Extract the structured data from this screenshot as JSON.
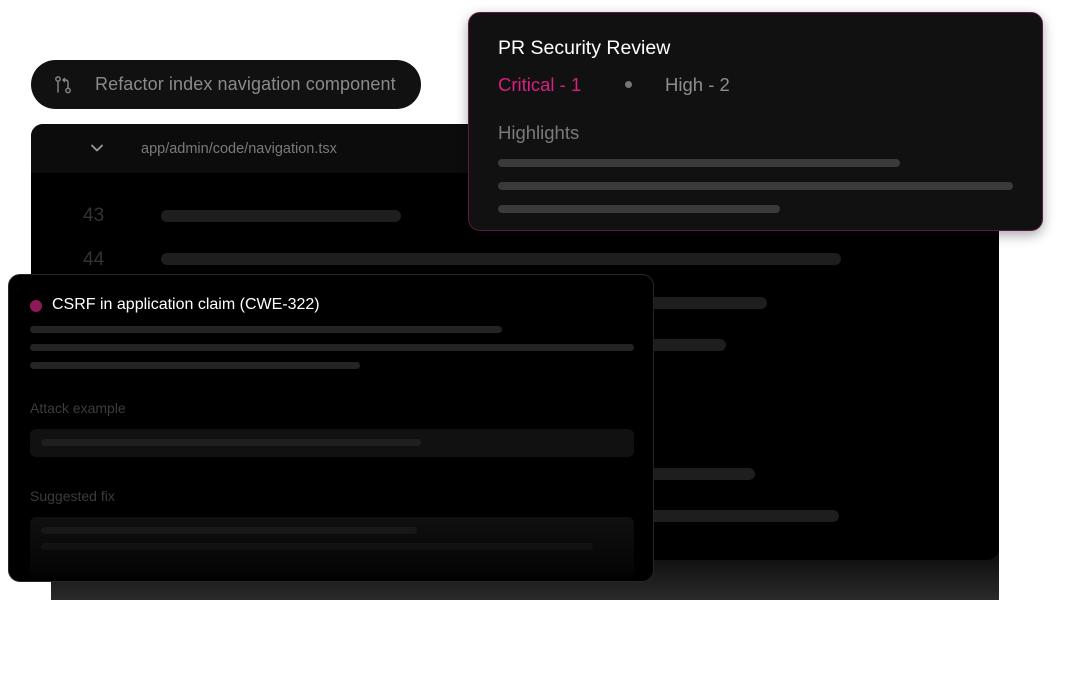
{
  "pull_request": {
    "icon": "git-pull-request-icon",
    "title": "Refactor index navigation component"
  },
  "editor": {
    "file_path": "app/admin/code/navigation.tsx",
    "collapse_icon": "chevron-down-icon",
    "line_numbers": [
      "43",
      "44"
    ]
  },
  "review": {
    "title": "PR Security Review",
    "critical_label": "Critical  - 1",
    "high_label": "High - 2",
    "highlights_label": "Highlights"
  },
  "vulnerability": {
    "title": "CSRF in application claim (CWE-322)",
    "attack_label": "Attack example",
    "fix_label": "Suggested fix"
  },
  "colors": {
    "critical": "#d7207f",
    "severity_dot": "#8d1a57",
    "review_border": "#5a1a45"
  }
}
